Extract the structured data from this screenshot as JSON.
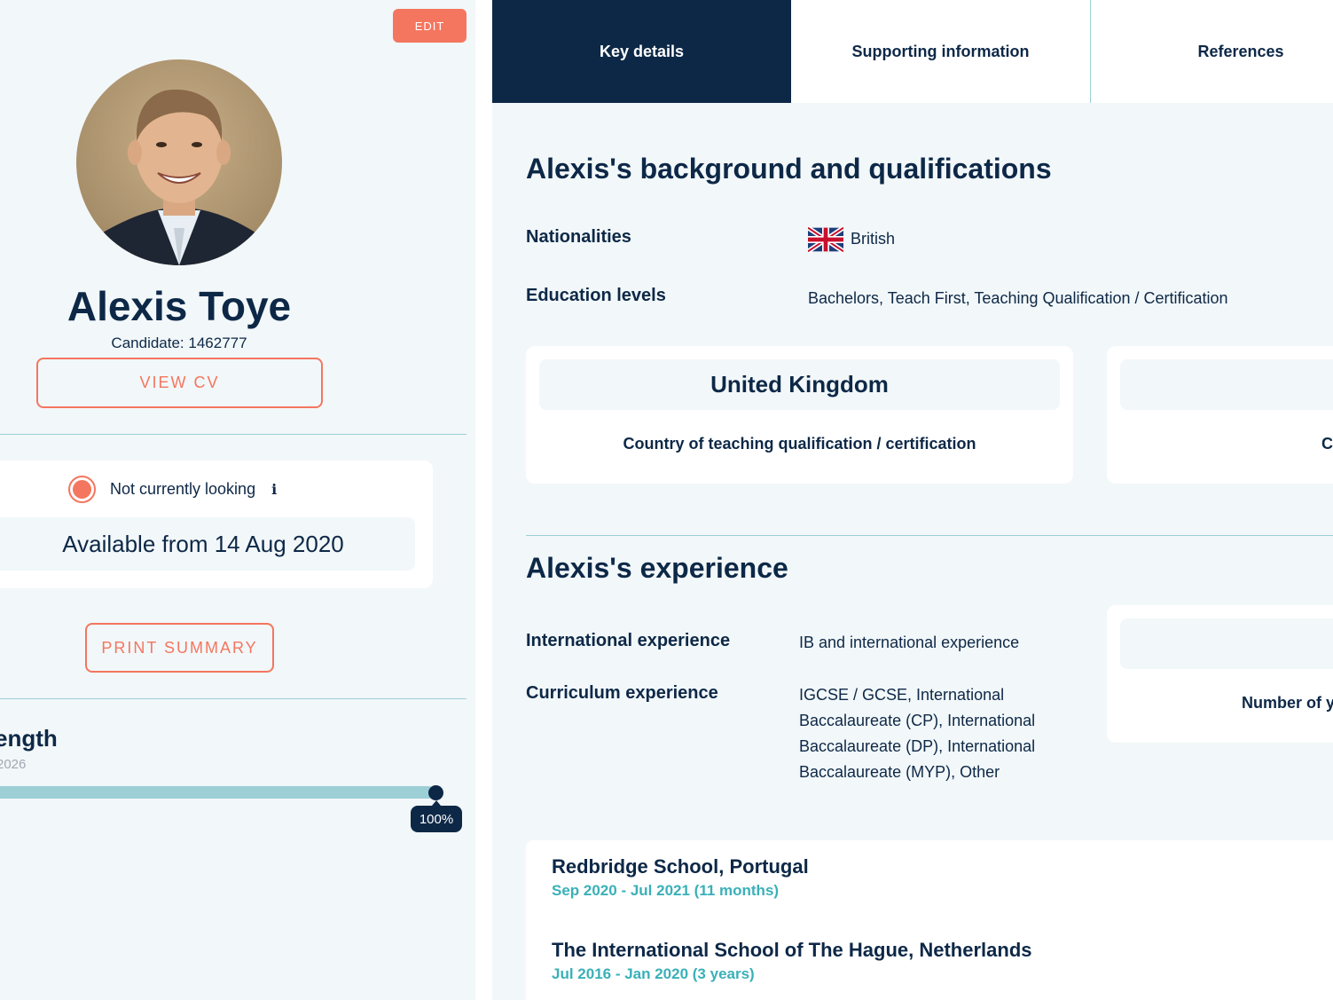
{
  "profile": {
    "edit_label": "EDIT",
    "name": "Alexis Toye",
    "candidate": "Candidate: 1462777",
    "view_cv_label": "VIEW CV",
    "status_text": "Not currently looking",
    "info_glyph": "i",
    "available": "Available from 14 Aug 2020",
    "print_label": "PRINT SUMMARY",
    "strength_title": "ength",
    "strength_date": "2026",
    "progress_percent": 100,
    "progress_label": "100%"
  },
  "tabs": [
    {
      "label": "Key details",
      "active": true
    },
    {
      "label": "Supporting information",
      "active": false
    },
    {
      "label": "References",
      "active": false
    }
  ],
  "background": {
    "title": "Alexis's background and qualifications",
    "nationalities_label": "Nationalities",
    "nationality": "British",
    "flag_icon": "uk-flag-icon",
    "education_label": "Education levels",
    "education_value": "Bachelors, Teach First, Teaching Qualification / Certification",
    "card1_head": "United Kingdom",
    "card1_sub": "Country of teaching qualification / certification",
    "card2_sub": "C"
  },
  "experience": {
    "title": "Alexis's experience",
    "international_label": "International experience",
    "international_value": "IB and international experience",
    "curriculum_label": "Curriculum experience",
    "curriculum_lines": [
      "IGCSE / GCSE, International",
      "Baccalaureate (CP), International",
      "Baccalaureate (DP), International",
      "Baccalaureate (MYP), Other"
    ],
    "years_card_sub": "Number of y",
    "jobs": [
      {
        "title": "Redbridge School, Portugal",
        "dates": "Sep 2020 - Jul 2021 (11 months)"
      },
      {
        "title": "The International School of The Hague, Netherlands",
        "dates": "Jul 2016 - Jan 2020 (3 years)"
      }
    ]
  },
  "colors": {
    "navy": "#0d2847",
    "coral": "#f4765f",
    "teal": "#3ab0b8",
    "light_bg": "#f2f7f9",
    "divider": "#9ccfd6"
  }
}
